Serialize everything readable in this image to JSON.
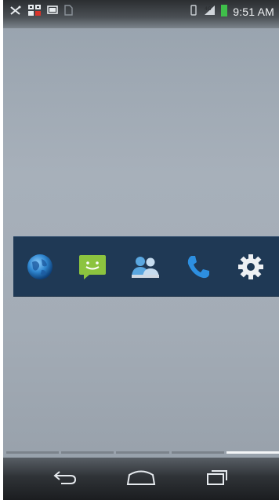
{
  "status_bar": {
    "time": "9:51 AM",
    "left_icons": [
      "missed-notification-icon",
      "qr-app-icon",
      "screenshot-icon",
      "sd-card-icon"
    ],
    "right_icons": [
      "vibrate-icon",
      "signal-4g-icon",
      "battery-icon"
    ]
  },
  "shortcut_bar": {
    "apps": [
      {
        "name": "browser-icon"
      },
      {
        "name": "messaging-icon"
      },
      {
        "name": "contacts-icon"
      },
      {
        "name": "phone-icon"
      },
      {
        "name": "settings-icon"
      }
    ]
  },
  "page_indicator": {
    "pages": 5,
    "current": 5
  },
  "nav_bar": {
    "buttons": [
      "back-icon",
      "home-icon",
      "recent-apps-icon"
    ]
  },
  "colors": {
    "dock": "#1f3955",
    "wallpaper": "#a3acb6",
    "accent_green": "#3fbf4a"
  }
}
